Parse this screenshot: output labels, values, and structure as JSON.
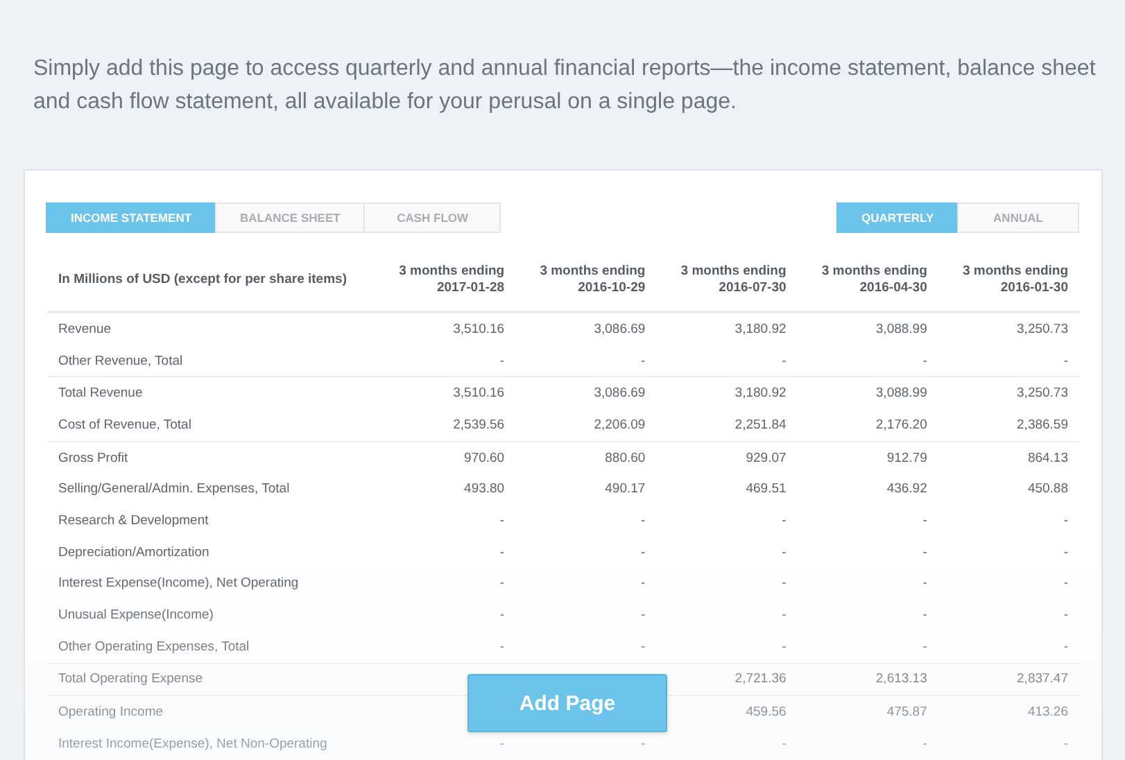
{
  "intro": "Simply add this page to access quarterly and annual financial reports—the income statement, balance sheet and cash flow statement, all available for your perusal on a single page.",
  "statement_tabs": [
    {
      "label": "INCOME STATEMENT",
      "selected": true
    },
    {
      "label": "BALANCE SHEET",
      "selected": false
    },
    {
      "label": "CASH FLOW",
      "selected": false
    }
  ],
  "period_tabs": [
    {
      "label": "QUARTERLY",
      "selected": true
    },
    {
      "label": "ANNUAL",
      "selected": false
    }
  ],
  "table": {
    "columns": [
      "In Millions of USD (except for per share items)",
      "3 months ending\n2017-01-28",
      "3 months ending\n2016-10-29",
      "3 months ending\n2016-07-30",
      "3 months ending\n2016-04-30",
      "3 months ending\n2016-01-30"
    ],
    "rows": [
      {
        "rule_above": false,
        "cells": [
          "Revenue",
          "3,510.16",
          "3,086.69",
          "3,180.92",
          "3,088.99",
          "3,250.73"
        ]
      },
      {
        "rule_above": false,
        "cells": [
          "Other Revenue, Total",
          "-",
          "-",
          "-",
          "-",
          "-"
        ]
      },
      {
        "rule_above": true,
        "cells": [
          "Total Revenue",
          "3,510.16",
          "3,086.69",
          "3,180.92",
          "3,088.99",
          "3,250.73"
        ]
      },
      {
        "rule_above": false,
        "cells": [
          "Cost of Revenue, Total",
          "2,539.56",
          "2,206.09",
          "2,251.84",
          "2,176.20",
          "2,386.59"
        ]
      },
      {
        "rule_above": true,
        "cells": [
          "Gross Profit",
          "970.60",
          "880.60",
          "929.07",
          "912.79",
          "864.13"
        ]
      },
      {
        "rule_above": false,
        "cells": [
          "Selling/General/Admin. Expenses, Total",
          "493.80",
          "490.17",
          "469.51",
          "436.92",
          "450.88"
        ]
      },
      {
        "rule_above": false,
        "cells": [
          "Research & Development",
          "-",
          "-",
          "-",
          "-",
          "-"
        ]
      },
      {
        "rule_above": false,
        "cells": [
          "Depreciation/Amortization",
          "-",
          "-",
          "-",
          "-",
          "-"
        ]
      },
      {
        "rule_above": false,
        "cells": [
          "Interest Expense(Income), Net Operating",
          "-",
          "-",
          "-",
          "-",
          "-"
        ]
      },
      {
        "rule_above": false,
        "cells": [
          "Unusual Expense(Income)",
          "-",
          "-",
          "-",
          "-",
          "-"
        ]
      },
      {
        "rule_above": false,
        "cells": [
          "Other Operating Expenses, Total",
          "-",
          "-",
          "-",
          "-",
          "-"
        ]
      },
      {
        "rule_above": true,
        "cells": [
          "Total Operating Expense",
          null,
          null,
          "2,721.36",
          "2,613.13",
          "2,837.47"
        ]
      },
      {
        "rule_above": true,
        "cells": [
          "Operating Income",
          null,
          null,
          "459.56",
          "475.87",
          "413.26"
        ]
      },
      {
        "rule_above": false,
        "cells": [
          "Interest Income(Expense), Net Non-Operating",
          "-",
          "-",
          "-",
          "-",
          "-"
        ]
      }
    ]
  },
  "add_button": "Add Page"
}
